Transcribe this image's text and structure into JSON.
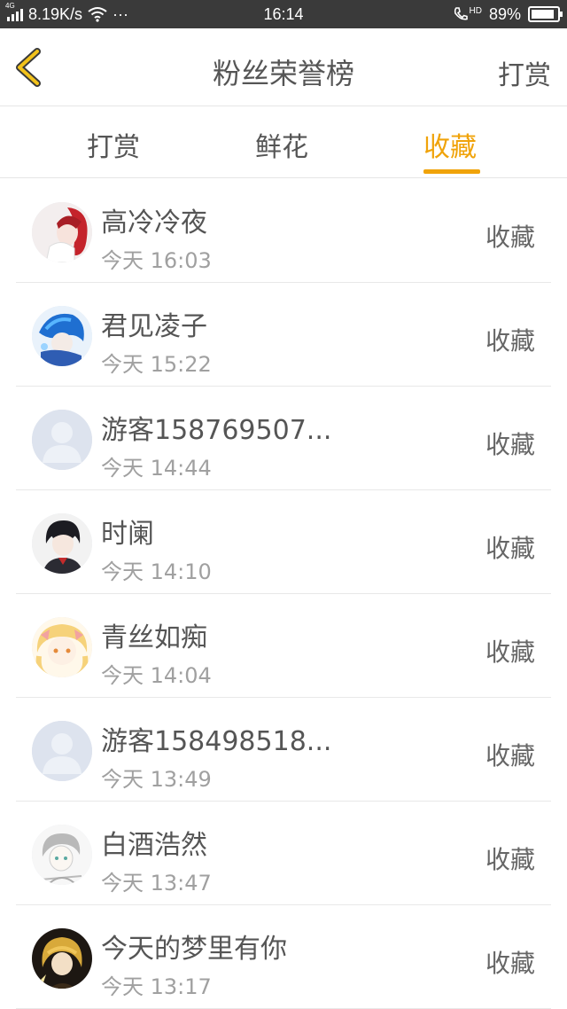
{
  "status_bar": {
    "network_type": "4G",
    "speed": "8.19K/s",
    "dots": "···",
    "time": "16:14",
    "hd": "HD",
    "battery_text": "89%",
    "battery_level": 0.89
  },
  "nav": {
    "title": "粉丝荣誉榜",
    "action": "打赏"
  },
  "tabs": [
    {
      "label": "打赏",
      "active": false
    },
    {
      "label": "鲜花",
      "active": false
    },
    {
      "label": "收藏",
      "active": true
    }
  ],
  "rows": [
    {
      "name": "高冷冷夜",
      "time": "今天 16:03",
      "action": "收藏",
      "avatar": "anime-red-hair"
    },
    {
      "name": "君见凌子",
      "time": "今天 15:22",
      "action": "收藏",
      "avatar": "anime-blue-hair"
    },
    {
      "name": "游客158769507...",
      "time": "今天 14:44",
      "action": "收藏",
      "avatar": "default-user"
    },
    {
      "name": "时阑",
      "time": "今天 14:10",
      "action": "收藏",
      "avatar": "anime-dark-hair"
    },
    {
      "name": "青丝如痴",
      "time": "今天 14:04",
      "action": "收藏",
      "avatar": "anime-blonde"
    },
    {
      "name": "游客158498518...",
      "time": "今天 13:49",
      "action": "收藏",
      "avatar": "default-user"
    },
    {
      "name": "白酒浩然",
      "time": "今天 13:47",
      "action": "收藏",
      "avatar": "anime-sketch"
    },
    {
      "name": "今天的梦里有你",
      "time": "今天 13:17",
      "action": "收藏",
      "avatar": "anime-gold-dark"
    }
  ]
}
